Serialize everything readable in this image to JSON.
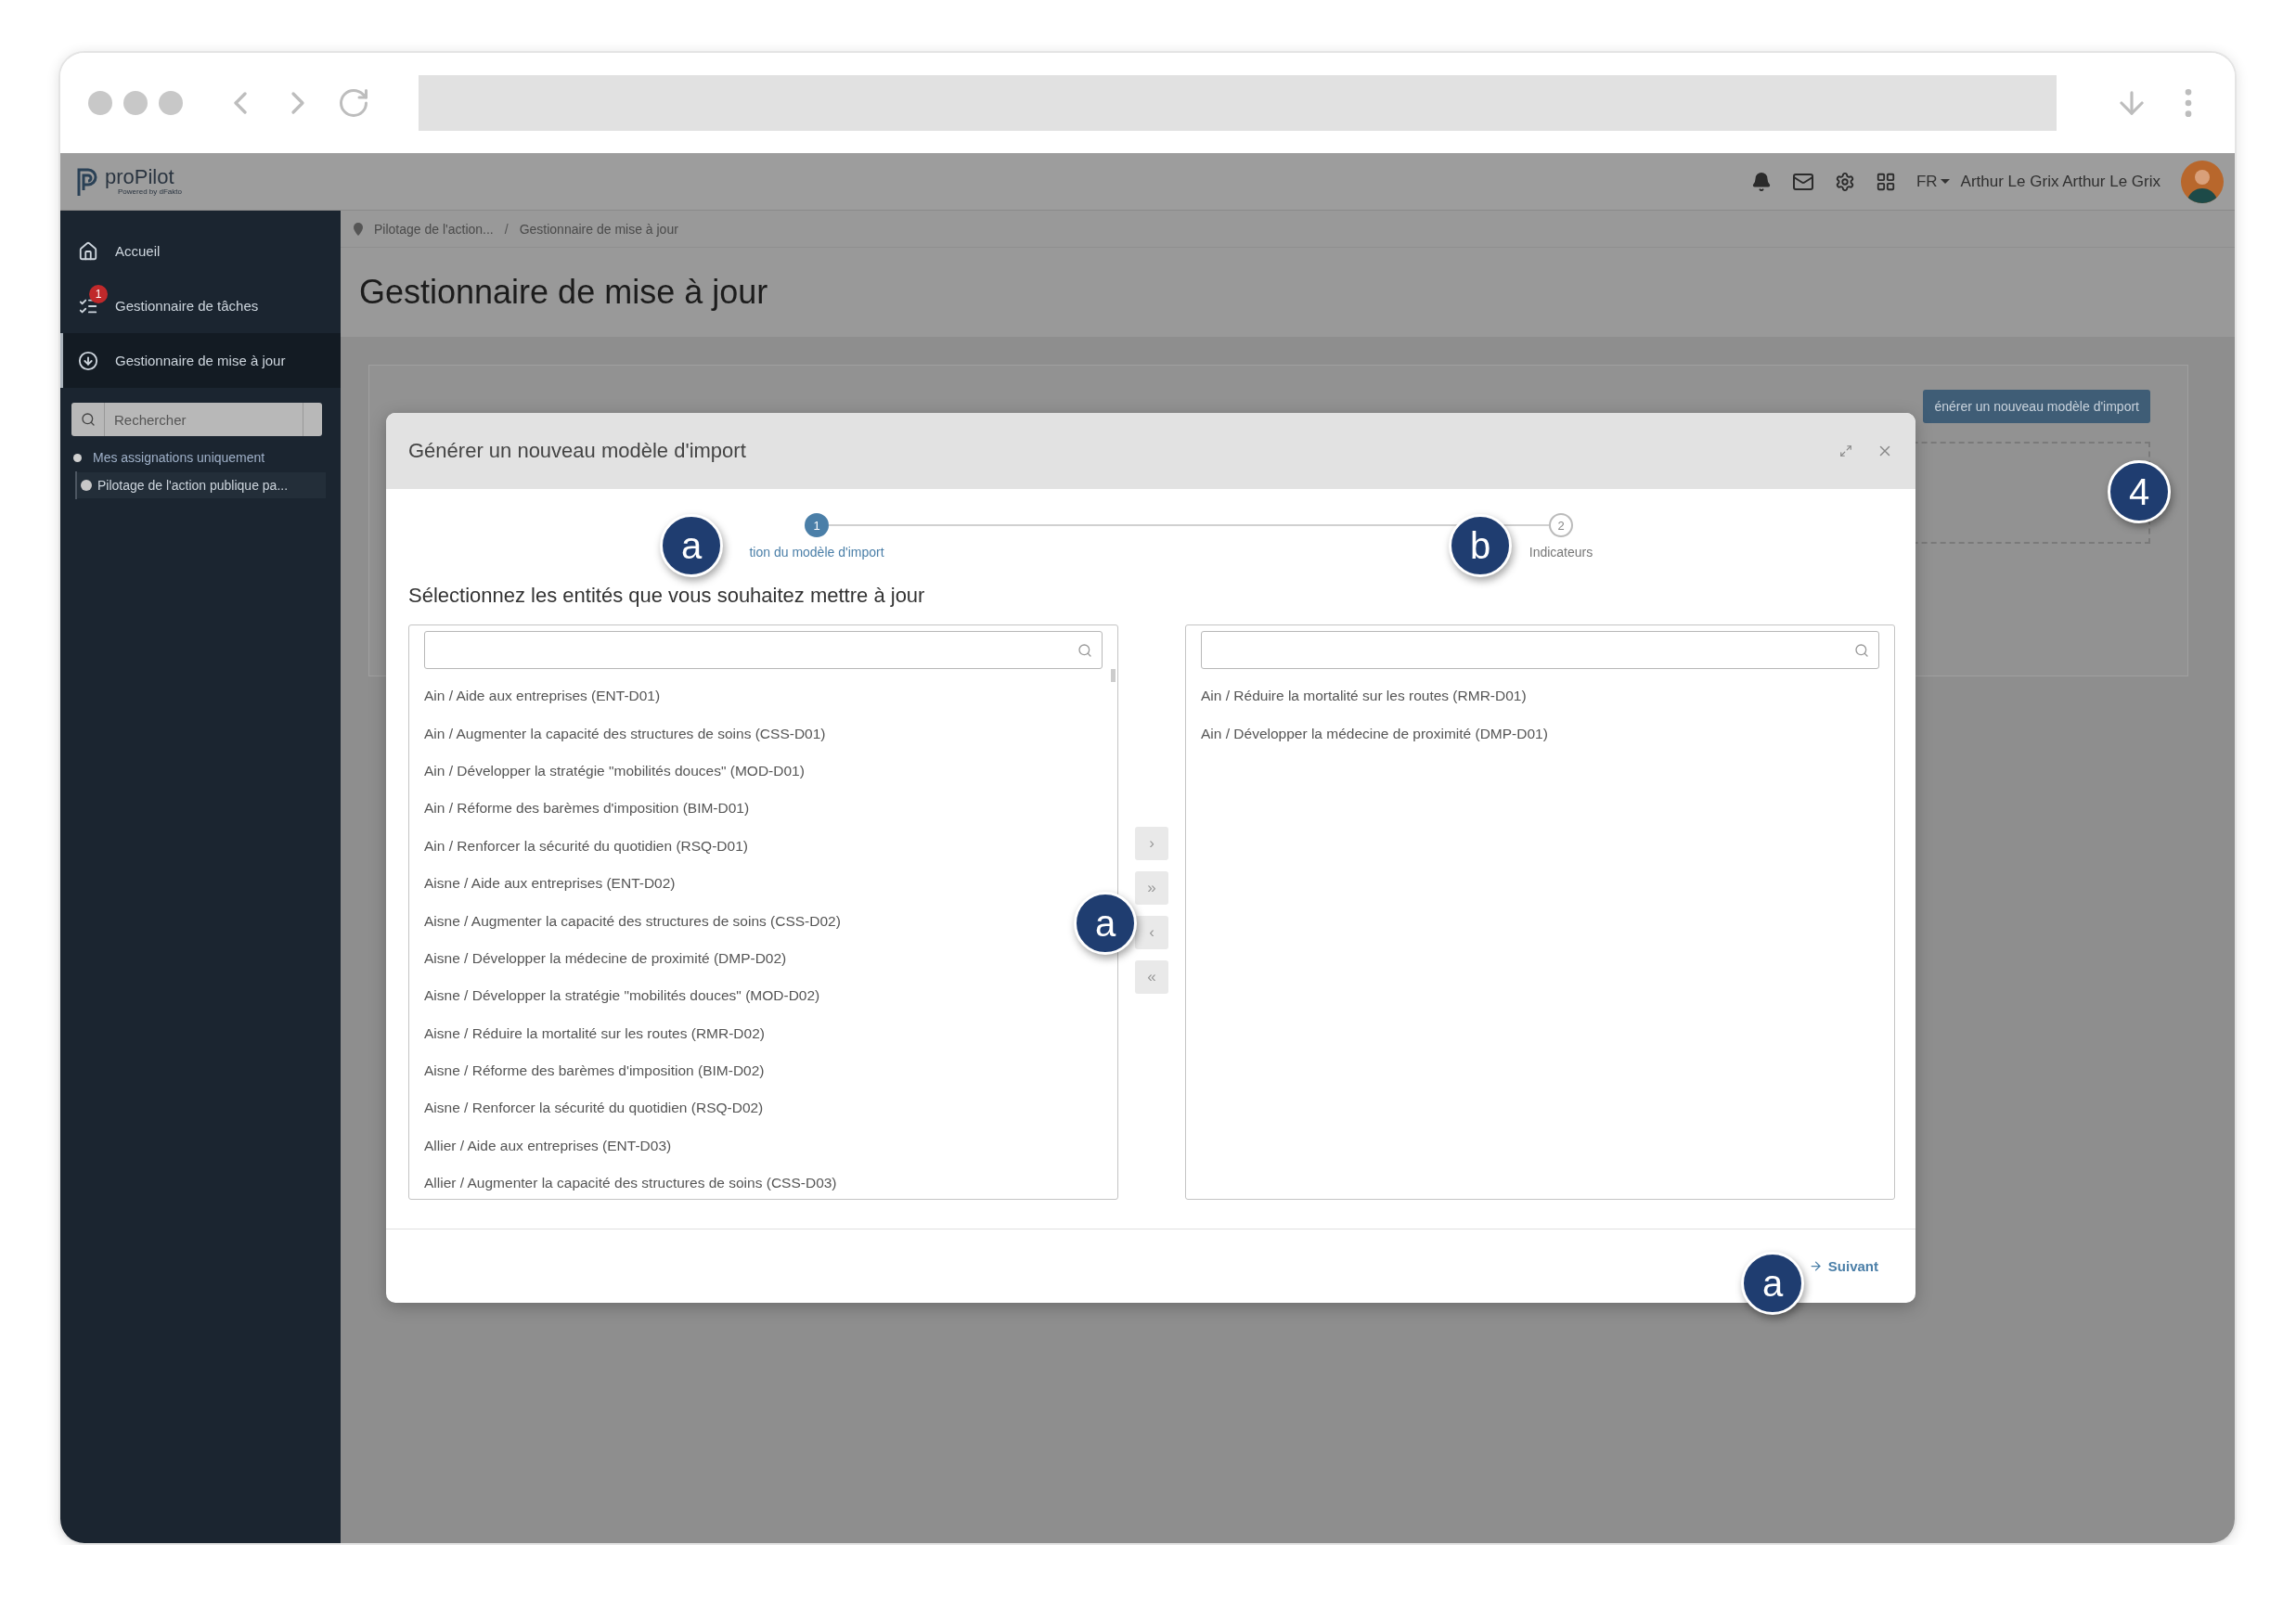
{
  "app": {
    "logo": {
      "name": "proPilot",
      "tagline": "Powered by dFakto"
    },
    "header": {
      "language": "FR",
      "user": "Arthur Le Grix Arthur Le Grix"
    }
  },
  "sidebar": {
    "items": [
      {
        "label": "Accueil",
        "selected": false
      },
      {
        "label": "Gestionnaire de tâches",
        "badge": "1",
        "selected": false
      },
      {
        "label": "Gestionnaire de mise à jour",
        "selected": true
      }
    ],
    "search": {
      "placeholder": "Rechercher"
    },
    "filter": {
      "label": "Mes assignations uniquement"
    },
    "tree": [
      {
        "label": "Pilotage de l'action publique pa..."
      }
    ]
  },
  "breadcrumb": {
    "separator": "/",
    "items": [
      "Pilotage de l'action...",
      "Gestionnaire de mise à jour"
    ]
  },
  "page_title": "Gestionnaire de mise à jour",
  "background_button": "énérer un nouveau modèle d'import",
  "modal": {
    "title": "Générer un nouveau modèle d'import",
    "steps": [
      {
        "number": "1",
        "label": "tion du modèle d'import",
        "selected": true
      },
      {
        "number": "2",
        "label": "Indicateurs",
        "selected": false
      }
    ],
    "instruction": "Sélectionnez les entités que vous souhaitez mettre à jour",
    "available": {
      "items": [
        "Ain / Aide aux entreprises (ENT-D01)",
        "Ain / Augmenter la capacité des structures de soins (CSS-D01)",
        "Ain / Développer la stratégie \"mobilités douces\" (MOD-D01)",
        "Ain / Réforme des barèmes d'imposition (BIM-D01)",
        "Ain / Renforcer la sécurité du quotidien (RSQ-D01)",
        "Aisne / Aide aux entreprises (ENT-D02)",
        "Aisne / Augmenter la capacité des structures de soins (CSS-D02)",
        "Aisne / Développer la médecine de proximité (DMP-D02)",
        "Aisne / Développer la stratégie \"mobilités douces\" (MOD-D02)",
        "Aisne / Réduire la mortalité sur les routes (RMR-D02)",
        "Aisne / Réforme des barèmes d'imposition (BIM-D02)",
        "Aisne / Renforcer la sécurité du quotidien (RSQ-D02)",
        "Allier / Aide aux entreprises (ENT-D03)",
        "Allier / Augmenter la capacité des structures de soins (CSS-D03)"
      ]
    },
    "chosen": {
      "items": [
        "Ain / Réduire la mortalité sur les routes (RMR-D01)",
        "Ain / Développer la médecine de proximité (DMP-D01)"
      ]
    },
    "transfer_buttons": [
      "›",
      "»",
      "‹",
      "«"
    ],
    "next_button": "Suivant"
  },
  "callouts": [
    {
      "label": "a"
    },
    {
      "label": "b"
    },
    {
      "label": "a"
    },
    {
      "label": "a"
    },
    {
      "label": "4"
    }
  ]
}
